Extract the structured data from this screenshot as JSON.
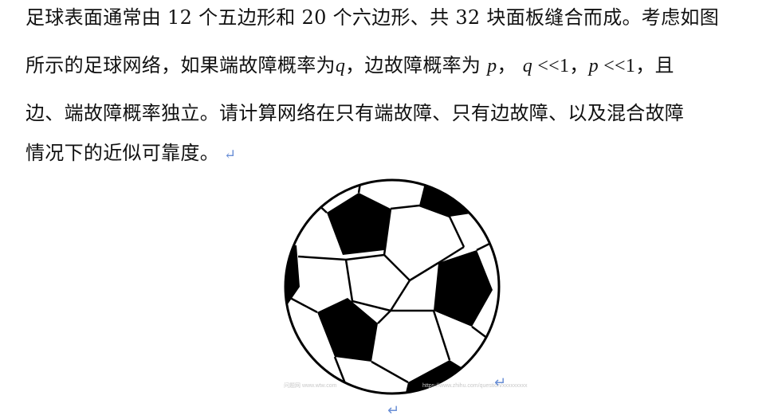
{
  "problem": {
    "line1": "足球表面通常由 12 个五边形和 20 个六边形、共 32 块面板缝合而成。考虑如图",
    "line2_a": "所示的足球网络，如果端故障概率为",
    "line2_q": "q",
    "line2_b": "，边故障概率为 ",
    "line2_p": "p",
    "line2_c": "，  ",
    "line2_cond1_var": "q",
    "line2_cond1_rel": " <<1",
    "line2_d": "，",
    "line2_cond2_var": "p",
    "line2_cond2_rel": " <<1",
    "line2_e": "，且",
    "line3": "边、端故障概率独立。请计算网络在只有端故障、只有边故障、以及混合故障",
    "line4": "情况下的近似可靠度。",
    "return_mark": "↵"
  },
  "figure": {
    "ball_icon": "soccer-ball",
    "watermark_left": "问题网 www.wtw.com",
    "watermark_right": "https://www.zhihu.com/question/xxxxxxxxx"
  },
  "colors": {
    "text": "#111111",
    "return_mark": "#6a8fd6",
    "ball_black": "#000000",
    "ball_white": "#ffffff"
  }
}
